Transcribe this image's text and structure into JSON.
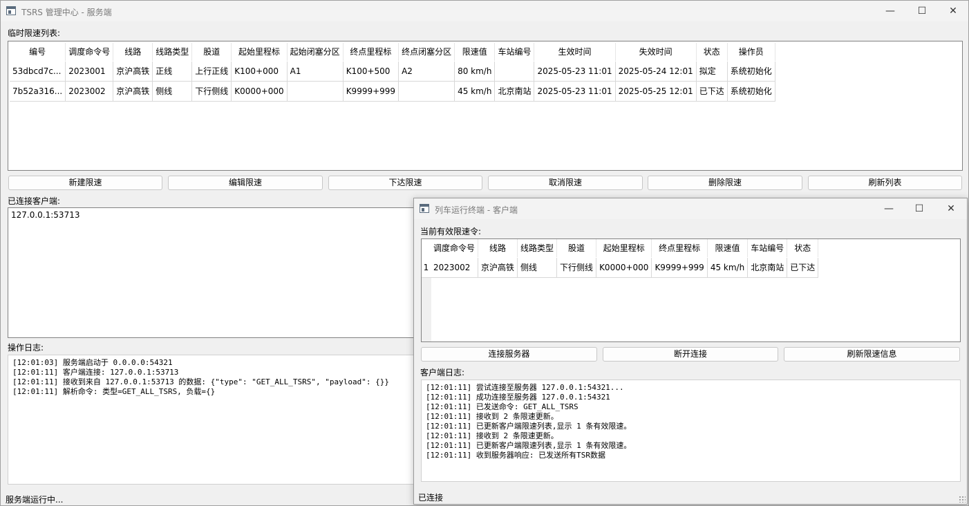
{
  "server": {
    "title": "TSRS 管理中心 - 服务端",
    "tsr_label": "临时限速列表:",
    "columns": [
      "编号",
      "调度命令号",
      "线路",
      "线路类型",
      "股道",
      "起始里程标",
      "起始闭塞分区",
      "终点里程标",
      "终点闭塞分区",
      "限速值",
      "车站编号",
      "生效时间",
      "失效时间",
      "状态",
      "操作员"
    ],
    "rows": [
      [
        "53dbcd7c...",
        "2023001",
        "京沪高铁",
        "正线",
        "上行正线",
        "K100+000",
        "A1",
        "K100+500",
        "A2",
        "80 km/h",
        "",
        "2025-05-23 11:01",
        "2025-05-24 12:01",
        "拟定",
        "系统初始化"
      ],
      [
        "7b52a316...",
        "2023002",
        "京沪高铁",
        "侧线",
        "下行侧线",
        "K0000+000",
        "",
        "K9999+999",
        "",
        "45 km/h",
        "北京南站",
        "2025-05-23 11:01",
        "2025-05-25 12:01",
        "已下达",
        "系统初始化"
      ]
    ],
    "buttons": {
      "new": "新建限速",
      "edit": "编辑限速",
      "issue": "下达限速",
      "cancel": "取消限速",
      "delete": "删除限速",
      "refresh": "刷新列表"
    },
    "clients_label": "已连接客户端:",
    "clients": [
      "127.0.0.1:53713"
    ],
    "log_label": "操作日志:",
    "log_lines": [
      "[12:01:03] 服务端启动于 0.0.0.0:54321",
      "[12:01:11] 客户端连接: 127.0.0.1:53713",
      "[12:01:11] 接收到来自 127.0.0.1:53713 的数据: {\"type\": \"GET_ALL_TSRS\", \"payload\": {}}",
      "[12:01:11] 解析命令: 类型=GET_ALL_TSRS, 负载={}"
    ],
    "status": "服务端运行中..."
  },
  "client": {
    "title": "列车运行终端 - 客户端",
    "active_label": "当前有效限速令:",
    "columns": [
      "调度命令号",
      "线路",
      "线路类型",
      "股道",
      "起始里程标",
      "终点里程标",
      "限速值",
      "车站编号",
      "状态"
    ],
    "rows": [
      {
        "index": "1",
        "cells": [
          "2023002",
          "京沪高铁",
          "侧线",
          "下行侧线",
          "K0000+000",
          "K9999+999",
          "45 km/h",
          "北京南站",
          "已下达"
        ]
      }
    ],
    "buttons": {
      "connect": "连接服务器",
      "disconnect": "断开连接",
      "refresh": "刷新限速信息"
    },
    "log_label": "客户端日志:",
    "log_lines": [
      "[12:01:11] 尝试连接至服务器 127.0.0.1:54321...",
      "[12:01:11] 成功连接至服务器 127.0.0.1:54321",
      "[12:01:11] 已发送命令: GET_ALL_TSRS",
      "[12:01:11] 接收到 2 条限速更新。",
      "[12:01:11] 已更新客户端限速列表,显示 1 条有效限速。",
      "[12:01:11] 接收到 2 条限速更新。",
      "[12:01:11] 已更新客户端限速列表,显示 1 条有效限速。",
      "[12:01:11] 收到服务器响应: 已发送所有TSR数据"
    ],
    "status": "已连接"
  },
  "window_controls": {
    "minimize": "—",
    "maximize": "☐",
    "close": "✕"
  }
}
